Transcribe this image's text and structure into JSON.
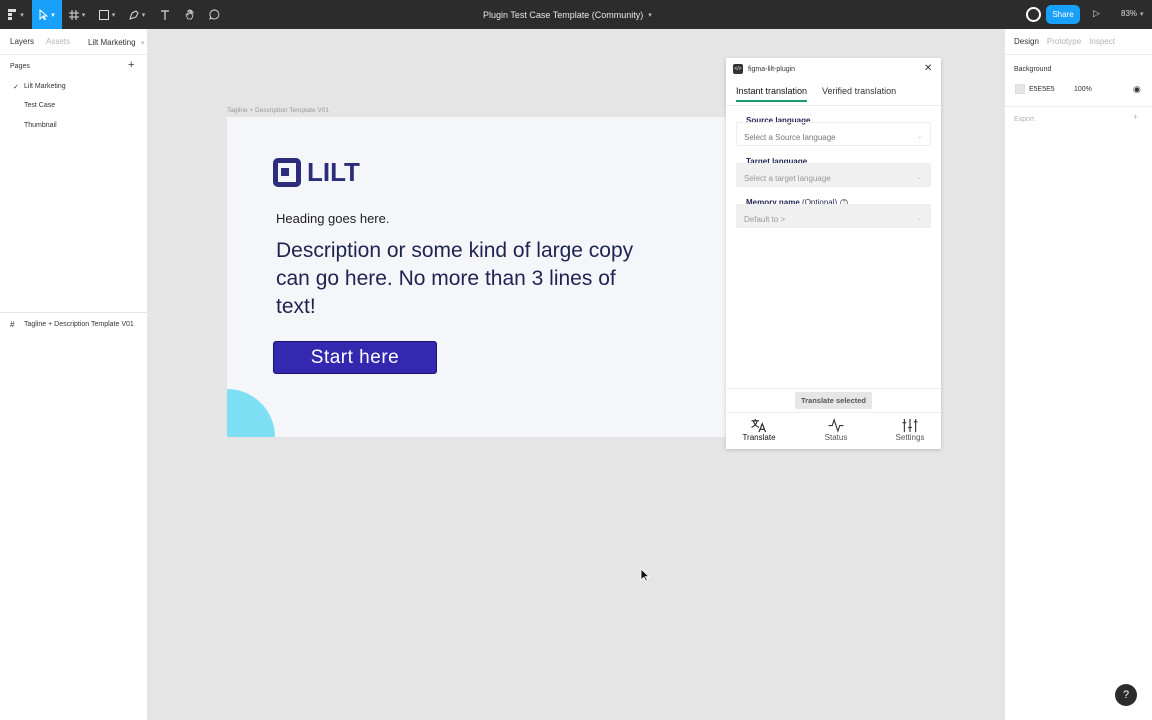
{
  "toolbar": {
    "doc_title": "Plugin Test Case Template (Community)",
    "share_label": "Share",
    "zoom_label": "83%"
  },
  "left_panel": {
    "tabs": [
      "Layers",
      "Assets"
    ],
    "page_selector": "Lilt Marketing",
    "pages_header": "Pages",
    "pages": [
      "Lilt Marketing",
      "Test Case",
      "Thumbnail"
    ],
    "selected_page_index": 0,
    "layers": [
      "Tagline + Description Template V01"
    ]
  },
  "right_panel": {
    "tabs": [
      "Design",
      "Prototype",
      "Inspect"
    ],
    "background_label": "Background",
    "background_hex": "E5E5E5",
    "background_opacity": "100%",
    "export_label": "Export"
  },
  "canvas": {
    "frame_label": "Tagline + Description Template V01",
    "logo_text": "LILT",
    "heading": "Heading goes here.",
    "description": "Description or some kind of large copy can go here. No more than 3 lines of text!",
    "cta_label": "Start here",
    "colors": {
      "brand": "#2b2d7a",
      "cta": "#3528b0",
      "accent": "#7fe0f5"
    }
  },
  "plugin": {
    "title": "figma-lilt-plugin",
    "tabs": [
      "Instant translation",
      "Verified translation"
    ],
    "active_tab": 0,
    "fields": [
      {
        "label": "Source language",
        "optional": "",
        "placeholder": "Select a Source language",
        "disabled": false
      },
      {
        "label": "Target language",
        "optional": "",
        "placeholder": "Select a target language",
        "disabled": true
      },
      {
        "label": "Memory name",
        "optional": "(Optional)",
        "placeholder": "Default to >",
        "disabled": true
      }
    ],
    "translate_button": "Translate selected",
    "nav": [
      {
        "label": "Translate",
        "icon": "translate-icon"
      },
      {
        "label": "Status",
        "icon": "activity-icon"
      },
      {
        "label": "Settings",
        "icon": "sliders-icon"
      }
    ]
  },
  "help_label": "?"
}
